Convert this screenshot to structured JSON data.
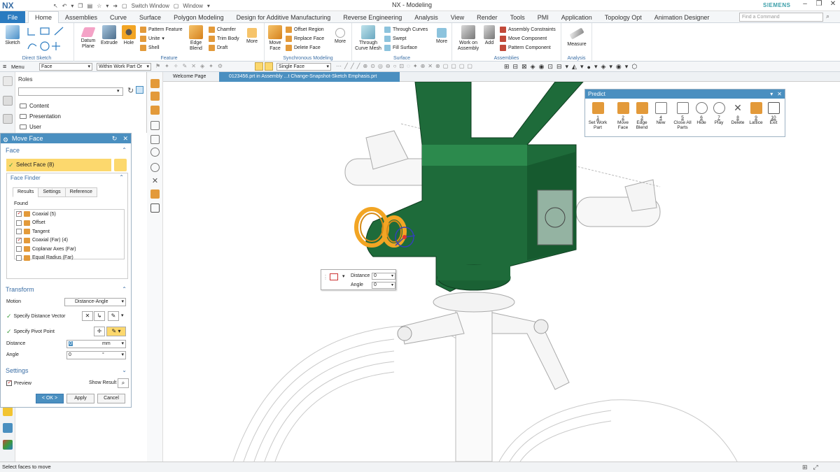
{
  "title_bar": {
    "app_logo": "NX",
    "switch_window": "Switch Window",
    "window_menu": "Window",
    "title": "NX - Modeling",
    "brand": "SIEMENS",
    "brand_color": "#3a9ea8"
  },
  "tabs": {
    "file": "File",
    "items": [
      "Home",
      "Assemblies",
      "Curve",
      "Surface",
      "Polygon Modeling",
      "Design for Additive Manufacturing",
      "Reverse Engineering",
      "Analysis",
      "View",
      "Render",
      "Tools",
      "PMI",
      "Application",
      "Topology Opt",
      "Animation Designer"
    ],
    "active": "Home",
    "find_placeholder": "Find a Command"
  },
  "ribbon": {
    "direct_sketch": {
      "label": "Direct Sketch",
      "sketch": "Sketch"
    },
    "feature": {
      "label": "Feature",
      "datum_plane": "Datum Plane",
      "extrude": "Extrude",
      "hole": "Hole",
      "pattern_feature": "Pattern Feature",
      "unite": "Unite",
      "shell": "Shell",
      "edge_blend": "Edge Blend",
      "chamfer": "Chamfer",
      "trim_body": "Trim Body",
      "draft": "Draft",
      "more": "More"
    },
    "synchronous": {
      "label": "Synchronous Modeling",
      "move_face": "Move Face",
      "offset_region": "Offset Region",
      "replace_face": "Replace Face",
      "delete_face": "Delete Face",
      "more": "More"
    },
    "surface": {
      "label": "Surface",
      "through_curve_mesh": "Through Curve Mesh",
      "through_curves": "Through Curves",
      "swept": "Swept",
      "fill_surface": "Fill Surface",
      "more": "More"
    },
    "assemblies": {
      "label": "Assemblies",
      "work_on_assembly": "Work on Assembly",
      "add": "Add",
      "assembly_constraints": "Assembly Constraints",
      "move_component": "Move Component",
      "pattern_component": "Pattern Component"
    },
    "analysis": {
      "label": "Analysis",
      "measure": "Measure"
    }
  },
  "command_bar": {
    "menu": "Menu",
    "filter": "Face",
    "scope": "Within Work Part Or",
    "face_rule": "Single Face"
  },
  "nav": {
    "title": "Roles",
    "folders": [
      "Content",
      "Presentation",
      "User"
    ]
  },
  "dialog": {
    "title": "Move Face",
    "face_section": "Face",
    "select_face": "Select Face (8)",
    "face_finder": "Face Finder",
    "finder_tabs": [
      "Results",
      "Settings",
      "Reference"
    ],
    "found_label": "Found",
    "found_items": [
      {
        "label": "Coaxial (5)",
        "checked": true
      },
      {
        "label": "Offset",
        "checked": false
      },
      {
        "label": "Tangent",
        "checked": false
      },
      {
        "label": "Coaxial (Far) (4)",
        "checked": true
      },
      {
        "label": "Coplanar Axes (Far)",
        "checked": false
      },
      {
        "label": "Equal Radius (Far)",
        "checked": false
      }
    ],
    "transform_section": "Transform",
    "motion_label": "Motion",
    "motion_value": "Distance-Angle",
    "distance_vector": "Specify Distance Vector",
    "pivot_point": "Specify Pivot Point",
    "distance_label": "Distance",
    "distance_value": "0",
    "distance_unit": "mm",
    "angle_label": "Angle",
    "angle_value": "0",
    "angle_unit": "°",
    "settings_section": "Settings",
    "preview": "Preview",
    "show_result": "Show Result",
    "ok": "< OK >",
    "apply": "Apply",
    "cancel": "Cancel"
  },
  "graphics_tabs": {
    "welcome": "Welcome Page",
    "active": "0123456.prt in Assembly ...t Change-Snapshot-Sketch Emphasis.prt"
  },
  "predict": {
    "title": "Predict",
    "items": [
      {
        "num": "1",
        "label": "Set Work Part"
      },
      {
        "num": "2",
        "label": "Move Face"
      },
      {
        "num": "3",
        "label": "Edge Blend"
      },
      {
        "num": "4",
        "label": "New"
      },
      {
        "num": "5",
        "label": "Close All Parts"
      },
      {
        "num": "6",
        "label": "Hide"
      },
      {
        "num": "7",
        "label": "Play"
      },
      {
        "num": "8",
        "label": "Delete"
      },
      {
        "num": "9",
        "label": "Lattice"
      },
      {
        "num": "10",
        "label": "Exit"
      }
    ]
  },
  "float_input": {
    "distance_label": "Distance",
    "distance_value": "0",
    "angle_label": "Angle",
    "angle_value": "0"
  },
  "status": {
    "text": "Select faces to move"
  },
  "colors": {
    "accent": "#2b7bc0",
    "dialog_header": "#4a8fc0",
    "highlight": "#fcd86d",
    "model_green": "#1e6b3a",
    "selected_orange": "#f2a524"
  }
}
